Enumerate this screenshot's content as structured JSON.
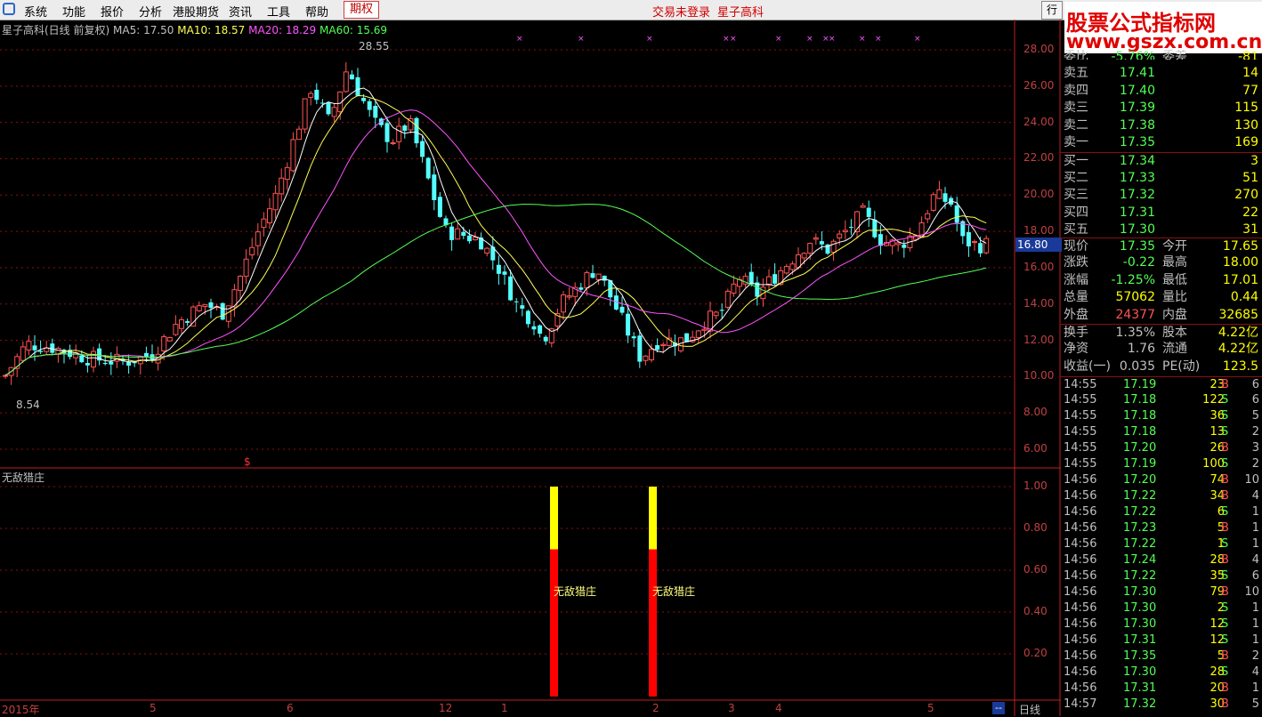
{
  "menu": {
    "items": [
      "系统",
      "功能",
      "报价",
      "分析",
      "港股期货",
      "资讯",
      "工具",
      "帮助"
    ],
    "active": "期权",
    "status_login": "交易未登录",
    "status_stock": "星子高科",
    "right_button": "行"
  },
  "watermark": {
    "line1": "股票公式指标网",
    "line2": "www.gszx.com.cn"
  },
  "chart_title": {
    "name": "星子高科(日线 前复权)",
    "ma5": "MA5: 17.50",
    "ma10": "MA10: 18.57",
    "ma20": "MA20: 18.29",
    "ma60": "MA60: 15.69"
  },
  "annotations": {
    "high": "28.55",
    "low": "8.54",
    "current_price_box": "16.80",
    "marker": "$"
  },
  "indicator": {
    "title": "无敌猎庄",
    "bar_label_1": "无敌猎庄",
    "bar_label_2": "无敌猎庄"
  },
  "yaxis_main": [
    "28.00",
    "26.00",
    "24.00",
    "22.00",
    "20.00",
    "18.00",
    "16.00",
    "14.00",
    "12.00",
    "10.00",
    "8.00",
    "6.00"
  ],
  "yaxis_indicator": [
    "1.00",
    "0.80",
    "0.60",
    "0.40",
    "0.20"
  ],
  "xaxis": [
    "2015年",
    "5",
    "6",
    "12",
    "1",
    "2",
    "3",
    "4",
    "5"
  ],
  "period": "日线",
  "period_btn": "--",
  "quote_top": {
    "label1": "委比",
    "v1": "-5.76%",
    "label2": "委差",
    "v2": "-81"
  },
  "order_book": [
    {
      "label": "卖五",
      "price": "17.41",
      "vol": "14"
    },
    {
      "label": "卖四",
      "price": "17.40",
      "vol": "77"
    },
    {
      "label": "卖三",
      "price": "17.39",
      "vol": "115"
    },
    {
      "label": "卖二",
      "price": "17.38",
      "vol": "130"
    },
    {
      "label": "卖一",
      "price": "17.35",
      "vol": "169"
    },
    {
      "label": "买一",
      "price": "17.34",
      "vol": "3"
    },
    {
      "label": "买二",
      "price": "17.33",
      "vol": "51"
    },
    {
      "label": "买三",
      "price": "17.32",
      "vol": "270"
    },
    {
      "label": "买四",
      "price": "17.31",
      "vol": "22"
    },
    {
      "label": "买五",
      "price": "17.30",
      "vol": "31"
    }
  ],
  "stats": [
    {
      "l1": "现价",
      "v1": "17.35",
      "c1": "g",
      "l2": "今开",
      "v2": "17.65",
      "c2": "r"
    },
    {
      "l1": "涨跌",
      "v1": "-0.22",
      "c1": "g",
      "l2": "最高",
      "v2": "18.00",
      "c2": "r"
    },
    {
      "l1": "涨幅",
      "v1": "-1.25%",
      "c1": "g",
      "l2": "最低",
      "v2": "17.01",
      "c2": "g"
    },
    {
      "l1": "总量",
      "v1": "57062",
      "c1": "y",
      "l2": "量比",
      "v2": "0.44",
      "c2": "y"
    },
    {
      "l1": "外盘",
      "v1": "24377",
      "c1": "r",
      "l2": "内盘",
      "v2": "32685",
      "c2": "g"
    },
    {
      "l1": "换手",
      "v1": "1.35%",
      "c1": "w",
      "l2": "股本",
      "v2": "4.22亿",
      "c2": "w"
    },
    {
      "l1": "净资",
      "v1": "1.76",
      "c1": "w",
      "l2": "流通",
      "v2": "4.22亿",
      "c2": "w"
    },
    {
      "l1": "收益(一)",
      "v1": "0.035",
      "c1": "w",
      "l2": "PE(动)",
      "v2": "123.5",
      "c2": "w"
    }
  ],
  "ticks": [
    {
      "t": "14:55",
      "p": "17.19",
      "v": "23",
      "d": "B",
      "n": "6"
    },
    {
      "t": "14:55",
      "p": "17.18",
      "v": "122",
      "d": "S",
      "n": "6"
    },
    {
      "t": "14:55",
      "p": "17.18",
      "v": "36",
      "d": "S",
      "n": "5"
    },
    {
      "t": "14:55",
      "p": "17.18",
      "v": "13",
      "d": "S",
      "n": "2"
    },
    {
      "t": "14:55",
      "p": "17.20",
      "v": "26",
      "d": "B",
      "n": "3"
    },
    {
      "t": "14:55",
      "p": "17.19",
      "v": "100",
      "d": "S",
      "n": "2"
    },
    {
      "t": "14:56",
      "p": "17.20",
      "v": "74",
      "d": "B",
      "n": "10"
    },
    {
      "t": "14:56",
      "p": "17.22",
      "v": "34",
      "d": "B",
      "n": "4"
    },
    {
      "t": "14:56",
      "p": "17.22",
      "v": "6",
      "d": "S",
      "n": "1"
    },
    {
      "t": "14:56",
      "p": "17.23",
      "v": "5",
      "d": "B",
      "n": "1"
    },
    {
      "t": "14:56",
      "p": "17.22",
      "v": "1",
      "d": "S",
      "n": "1"
    },
    {
      "t": "14:56",
      "p": "17.24",
      "v": "28",
      "d": "B",
      "n": "4"
    },
    {
      "t": "14:56",
      "p": "17.22",
      "v": "35",
      "d": "S",
      "n": "6"
    },
    {
      "t": "14:56",
      "p": "17.30",
      "v": "79",
      "d": "B",
      "n": "10"
    },
    {
      "t": "14:56",
      "p": "17.30",
      "v": "2",
      "d": "S",
      "n": "1"
    },
    {
      "t": "14:56",
      "p": "17.30",
      "v": "12",
      "d": "S",
      "n": "1"
    },
    {
      "t": "14:56",
      "p": "17.31",
      "v": "12",
      "d": "S",
      "n": "1"
    },
    {
      "t": "14:56",
      "p": "17.35",
      "v": "5",
      "d": "B",
      "n": "2"
    },
    {
      "t": "14:56",
      "p": "17.30",
      "v": "28",
      "d": "S",
      "n": "4"
    },
    {
      "t": "14:56",
      "p": "17.31",
      "v": "20",
      "d": "B",
      "n": "1"
    },
    {
      "t": "14:57",
      "p": "17.32",
      "v": "30",
      "d": "B",
      "n": "5"
    }
  ],
  "colors": {
    "up": "#ff5454",
    "down": "#54ffff",
    "ma5": "#ffffff",
    "ma10": "#ffff54",
    "ma20": "#ff54ff",
    "ma60": "#54ff54",
    "grid": "#8a1010"
  }
}
